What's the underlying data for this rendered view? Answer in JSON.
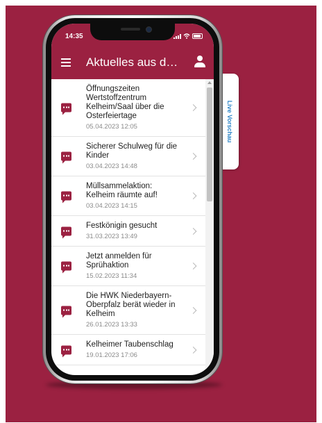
{
  "status_bar": {
    "time": "14:35",
    "icons": [
      "signal-icon",
      "wifi-icon",
      "battery-icon"
    ]
  },
  "app_bar": {
    "title": "Aktuelles aus de...",
    "menu_icon": "menu-icon",
    "user_icon": "user-icon"
  },
  "side_tab": {
    "label": "Live Vorschau"
  },
  "news": {
    "items": [
      {
        "title": "Öffnungszeiten Wertstoffzentrum Kelheim/Saal über die Osterfeiertage",
        "date": "05.04.2023 12:05"
      },
      {
        "title": "Sicherer Schulweg für die Kinder",
        "date": "03.04.2023 14:48"
      },
      {
        "title": "Müllsammelaktion: Kelheim räumte auf!",
        "date": "03.04.2023 14:15"
      },
      {
        "title": "Festkönigin gesucht",
        "date": "31.03.2023 13:49"
      },
      {
        "title": "Jetzt anmelden für Sprühaktion",
        "date": "15.02.2023 11:34"
      },
      {
        "title": "Die HWK Niederbayern-Oberpfalz berät wieder in Kelheim",
        "date": "26.01.2023 13:33"
      },
      {
        "title": "Kelheimer Taubenschlag",
        "date": "19.01.2023 17:06"
      }
    ]
  },
  "colors": {
    "brand": "#9b2141",
    "text": "#1e1e1e",
    "date": "#8a8a8a",
    "link": "#2e86c8"
  }
}
